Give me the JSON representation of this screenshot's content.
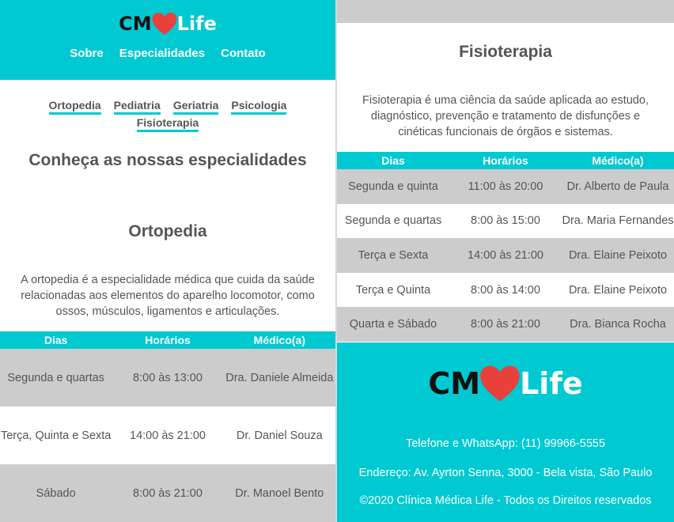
{
  "brand": {
    "cm": "CM",
    "life": "Life",
    "heart_color": "#e8413c",
    "accent": "#00c9d2"
  },
  "nav": [
    "Sobre",
    "Especialidades",
    "Contato"
  ],
  "specialties": [
    "Ortopedia",
    "Pediatria",
    "Geriatria",
    "Psicologia",
    "Fisioterapia"
  ],
  "page_title": "Conheça as nossas especialidades",
  "table_headers": [
    "Dias",
    "Horários",
    "Médico(a)"
  ],
  "ortopedia": {
    "title": "Ortopedia",
    "description": "A ortopedia é a especialidade médica que cuida da saúde relacionadas aos elementos do aparelho locomotor, como ossos, músculos, ligamentos e articulações.",
    "rows": [
      [
        "Segunda e quartas",
        "8:00 às 13:00",
        "Dra. Daniele Almeida"
      ],
      [
        "Terça, Quinta e Sexta",
        "14:00 às 21:00",
        "Dr. Daniel Souza"
      ],
      [
        "Sábado",
        "8:00 às 21:00",
        "Dr. Manoel Bento"
      ]
    ]
  },
  "fisioterapia": {
    "title": "Fisioterapia",
    "description": "Fisioterapia é uma ciência da saúde aplicada ao estudo, diagnóstico, prevenção e tratamento de disfunções e cinéticas funcionais de órgãos e sistemas.",
    "rows": [
      [
        "Segunda e quinta",
        "11:00 às 20:00",
        "Dr. Alberto de Paula"
      ],
      [
        "Segunda e quartas",
        "8:00 às 15:00",
        "Dra. Maria Fernandes"
      ],
      [
        "Terça e Sexta",
        "14:00 às 21:00",
        "Dra. Elaine Peixoto"
      ],
      [
        "Terça e Quinta",
        "8:00 às 14:00",
        "Dra. Elaine Peixoto"
      ],
      [
        "Quarta e Sábado",
        "8:00 às 21:00",
        "Dra. Bianca Rocha"
      ]
    ]
  },
  "footer": {
    "phone": "Telefone e WhatsApp: (11) 99966-5555",
    "address": "Endereço: Av. Ayrton Senna, 3000 - Bela vista, São Paulo",
    "copyright": "©2020 Clínica Médica Life - Todos os Direitos reservados"
  }
}
